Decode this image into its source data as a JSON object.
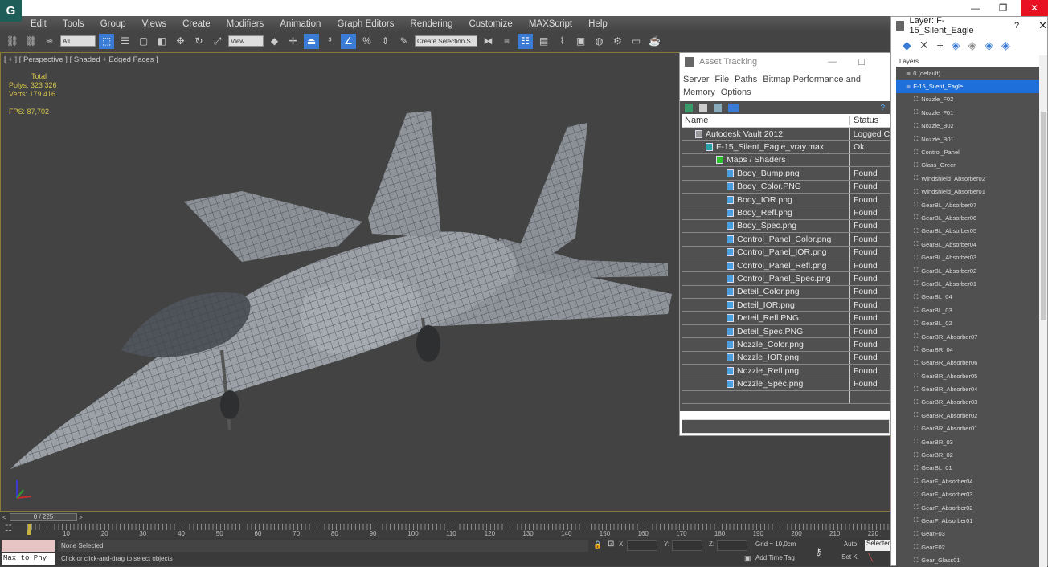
{
  "app": {
    "logo_glyph": "G"
  },
  "window_controls": {
    "minimize": "—",
    "restore": "❐",
    "close": "✕"
  },
  "menu": [
    "Edit",
    "Tools",
    "Group",
    "Views",
    "Create",
    "Modifiers",
    "Animation",
    "Graph Editors",
    "Rendering",
    "Customize",
    "MAXScript",
    "Help"
  ],
  "toolbar": {
    "selection_filter": "All",
    "reference_coord": "View",
    "named_selection_placeholder": "Create Selection S"
  },
  "viewport": {
    "label": "[ + ] [ Perspective ] [ Shaded + Edged Faces ]",
    "stats_title": "Total",
    "polys_label": "Polys:",
    "polys_value": "323 326",
    "verts_label": "Verts:",
    "verts_value": "179 416",
    "fps_label": "FPS:",
    "fps_value": "87,702"
  },
  "asset_tracking": {
    "title": "Asset Tracking",
    "menu": [
      "Server",
      "File",
      "Paths",
      "Bitmap Performance and Memory",
      "Options"
    ],
    "columns": [
      "Name",
      "Status"
    ],
    "rows": [
      {
        "name": "Autodesk Vault 2012",
        "status": "Logged C",
        "level": 1,
        "icon": "vault-icon"
      },
      {
        "name": "F-15_Silent_Eagle_vray.max",
        "status": "Ok",
        "level": 2,
        "icon": "max-file-icon"
      },
      {
        "name": "Maps / Shaders",
        "status": "",
        "level": 3,
        "icon": "maps-icon"
      },
      {
        "name": "Body_Bump.png",
        "status": "Found",
        "level": 4,
        "icon": "image-file-icon"
      },
      {
        "name": "Body_Color.PNG",
        "status": "Found",
        "level": 4,
        "icon": "image-file-icon"
      },
      {
        "name": "Body_IOR.png",
        "status": "Found",
        "level": 4,
        "icon": "image-file-icon"
      },
      {
        "name": "Body_Refl.png",
        "status": "Found",
        "level": 4,
        "icon": "image-file-icon"
      },
      {
        "name": "Body_Spec.png",
        "status": "Found",
        "level": 4,
        "icon": "image-file-icon"
      },
      {
        "name": "Control_Panel_Color.png",
        "status": "Found",
        "level": 4,
        "icon": "image-file-icon"
      },
      {
        "name": "Control_Panel_IOR.png",
        "status": "Found",
        "level": 4,
        "icon": "image-file-icon"
      },
      {
        "name": "Control_Panel_Refl.png",
        "status": "Found",
        "level": 4,
        "icon": "image-file-icon"
      },
      {
        "name": "Control_Panel_Spec.png",
        "status": "Found",
        "level": 4,
        "icon": "image-file-icon"
      },
      {
        "name": "Deteil_Color.png",
        "status": "Found",
        "level": 4,
        "icon": "image-file-icon"
      },
      {
        "name": "Deteil_IOR.png",
        "status": "Found",
        "level": 4,
        "icon": "image-file-icon"
      },
      {
        "name": "Deteil_Refl.PNG",
        "status": "Found",
        "level": 4,
        "icon": "image-file-icon"
      },
      {
        "name": "Deteil_Spec.PNG",
        "status": "Found",
        "level": 4,
        "icon": "image-file-icon"
      },
      {
        "name": "Nozzle_Color.png",
        "status": "Found",
        "level": 4,
        "icon": "image-file-icon"
      },
      {
        "name": "Nozzle_IOR.png",
        "status": "Found",
        "level": 4,
        "icon": "image-file-icon"
      },
      {
        "name": "Nozzle_Refl.png",
        "status": "Found",
        "level": 4,
        "icon": "image-file-icon"
      },
      {
        "name": "Nozzle_Spec.png",
        "status": "Found",
        "level": 4,
        "icon": "image-file-icon"
      }
    ]
  },
  "layer_window": {
    "title": "Layer: F-15_Silent_Eagle",
    "help": "?",
    "close": "✕",
    "list_header": "Layers",
    "layers": [
      {
        "name": "0 (default)",
        "type": "layer"
      },
      {
        "name": "F-15_Silent_Eagle",
        "type": "layer",
        "selected": true
      }
    ],
    "objects": [
      "Nozzle_F02",
      "Nozzle_F01",
      "Nozzle_B02",
      "Nozzle_B01",
      "Control_Panel",
      "Glass_Green",
      "Windshield_Absorber02",
      "Windshield_Absorber01",
      "GearBL_Absorber07",
      "GearBL_Absorber06",
      "GearBL_Absorber05",
      "GearBL_Absorber04",
      "GearBL_Absorber03",
      "GearBL_Absorber02",
      "GearBL_Absorber01",
      "GearBL_04",
      "GearBL_03",
      "GearBL_02",
      "GearBR_Absorber07",
      "GearBR_04",
      "GearBR_Absorber06",
      "GearBR_Absorber05",
      "GearBR_Absorber04",
      "GearBR_Absorber03",
      "GearBR_Absorber02",
      "GearBR_Absorber01",
      "GearBR_03",
      "GearBR_02",
      "GearBL_01",
      "GearF_Absorber04",
      "GearF_Absorber03",
      "GearF_Absorber02",
      "GearF_Absorber01",
      "GearF03",
      "GearF02",
      "Gear_Glass01"
    ]
  },
  "timeline": {
    "frame_display": "0 / 225",
    "prev": "<",
    "next": ">",
    "ticks": [
      "10",
      "20",
      "30",
      "40",
      "50",
      "60",
      "70",
      "80",
      "90",
      "100",
      "110",
      "120",
      "130",
      "140",
      "150",
      "160",
      "170",
      "180",
      "190",
      "200",
      "210",
      "220"
    ]
  },
  "status": {
    "maxscript_text": "Max to Phy",
    "selection": "None Selected",
    "prompt": "Click or click-and-drag to select objects",
    "x_label": "X:",
    "y_label": "Y:",
    "z_label": "Z:",
    "grid": "Grid = 10,0cm",
    "add_time_tag": "Add Time Tag",
    "auto_key": "Auto",
    "set_key": "Set K.",
    "key_filter": "Selected"
  }
}
